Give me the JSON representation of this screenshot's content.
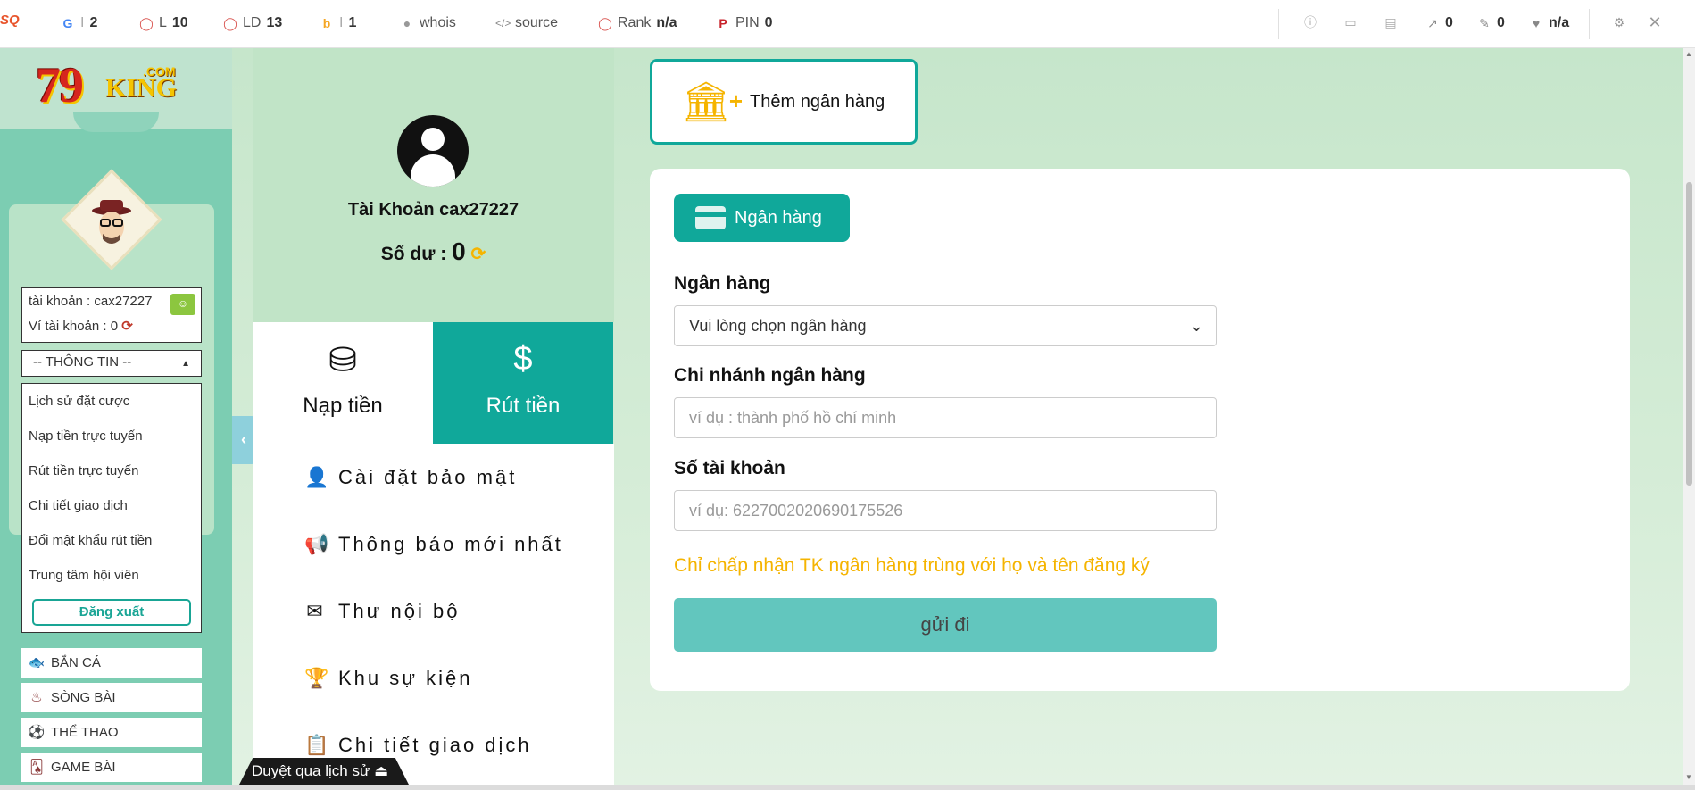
{
  "seo_toolbar": {
    "items": [
      {
        "label": "I",
        "value": "2",
        "icon": "google-icon"
      },
      {
        "label": "L",
        "value": "10",
        "icon": "circle-icon"
      },
      {
        "label": "LD",
        "value": "13",
        "icon": "circle-icon"
      },
      {
        "label": "I",
        "value": "1",
        "icon": "bing-icon"
      },
      {
        "label": "whois",
        "value": "",
        "icon": "user-icon"
      },
      {
        "label": "source",
        "value": "",
        "icon": "code-icon"
      },
      {
        "label": "Rank",
        "value": "n/a",
        "icon": "circle-icon"
      },
      {
        "label": "PIN",
        "value": "0",
        "icon": "pinterest-icon"
      }
    ],
    "right_values": {
      "external": "0",
      "edit": "0",
      "heart": "n/a"
    }
  },
  "sidebar": {
    "logo": {
      "number": "79",
      "king": "KING",
      "com": ".COM"
    },
    "account_line": "tài khoản : cax27227",
    "wallet_line": "Ví tài khoản : 0",
    "info_select": "-- THÔNG TIN --",
    "dropdown_items": [
      "Lịch sử đặt cược",
      "Nạp tiền trực tuyến",
      "Rút tiền trực tuyến",
      "Chi tiết giao dịch",
      "Đổi mật khẩu rút tiền",
      "Trung tâm hội viên"
    ],
    "logout": "Đăng xuất",
    "games": [
      "BẮN CÁ",
      "SÒNG BÀI",
      "THỂ THAO",
      "GAME BÀI"
    ]
  },
  "profile": {
    "account": "Tài Khoản cax27227",
    "balance_label": "Số dư :",
    "balance_value": "0"
  },
  "tabs": {
    "deposit": "Nạp tiền",
    "withdraw": "Rút tiền"
  },
  "menu": [
    "Cài đặt bảo mật",
    "Thông báo mới nhất",
    "Thư nội bộ",
    "Khu sự kiện",
    "Chi tiết giao dịch"
  ],
  "history_bar": "Duyệt qua lịch sử",
  "add_bank": "Thêm ngân hàng",
  "form": {
    "pill": "Ngân hàng",
    "bank_label": "Ngân hàng",
    "bank_select": "Vui lòng chọn ngân hàng",
    "branch_label": "Chi nhánh ngân hàng",
    "branch_placeholder": "ví dụ : thành phố hồ chí minh",
    "account_label": "Số tài khoản",
    "account_placeholder": "ví dụ:  6227002020690175526",
    "note": "Chỉ chấp nhận TK ngân hàng trùng với họ và tên đăng ký",
    "submit": "gửi đi"
  },
  "colors": {
    "teal": "#10a89a",
    "gold": "#f5b400",
    "mint": "#c1e4c7"
  }
}
